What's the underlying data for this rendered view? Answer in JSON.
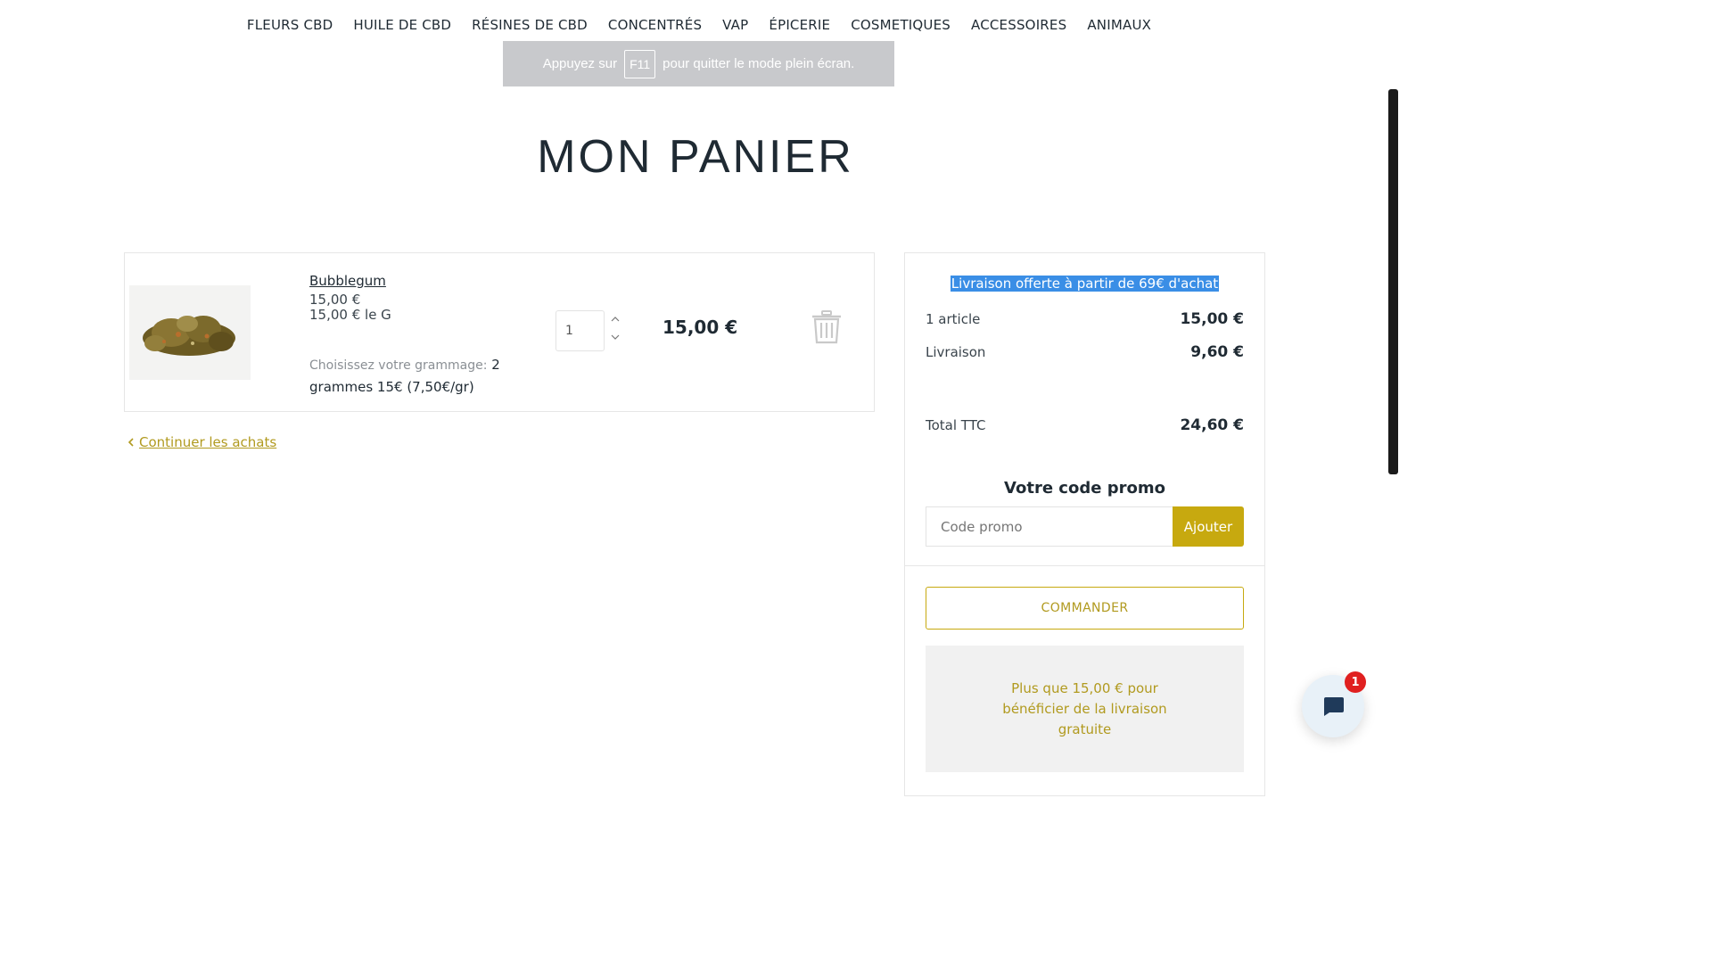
{
  "nav": {
    "items": [
      "FLEURS CBD",
      "HUILE DE CBD",
      "RÉSINES DE CBD",
      "CONCENTRÉS",
      "VAP",
      "ÉPICERIE",
      "COSMETIQUES",
      "ACCESSOIRES",
      "ANIMAUX"
    ]
  },
  "fullscreen_banner": {
    "before": "Appuyez sur",
    "key": "F11",
    "after": "pour quitter le mode plein écran."
  },
  "page": {
    "title": "MON PANIER"
  },
  "cart": {
    "item": {
      "name": "Bubblegum",
      "price": "15,00 €",
      "unit_price": "15,00 € le G",
      "variant_label": "Choisissez votre grammage:",
      "variant_value": "2 grammes 15€ (7,50€/gr)",
      "quantity": "1",
      "line_total": "15,00 €"
    },
    "continue_label": "Continuer les achats"
  },
  "summary": {
    "free_shipping_text": "Livraison offerte à partir de 69€ d'achat",
    "rows": [
      {
        "label": "1 article",
        "value": "15,00 €"
      },
      {
        "label": "Livraison",
        "value": "9,60 €"
      },
      {
        "label": "Total TTC",
        "value": "24,60 €"
      }
    ],
    "promo_title": "Votre code promo",
    "promo_placeholder": "Code promo",
    "promo_button": "Ajouter",
    "order_button": "COMMANDER",
    "notice": "Plus que 15,00 € pour bénéficier de la livraison gratuite"
  },
  "chat": {
    "badge_count": "1"
  },
  "colors": {
    "accent": "#c7a90f",
    "text": "#1f2a33",
    "selection": "#3a8ee6"
  }
}
